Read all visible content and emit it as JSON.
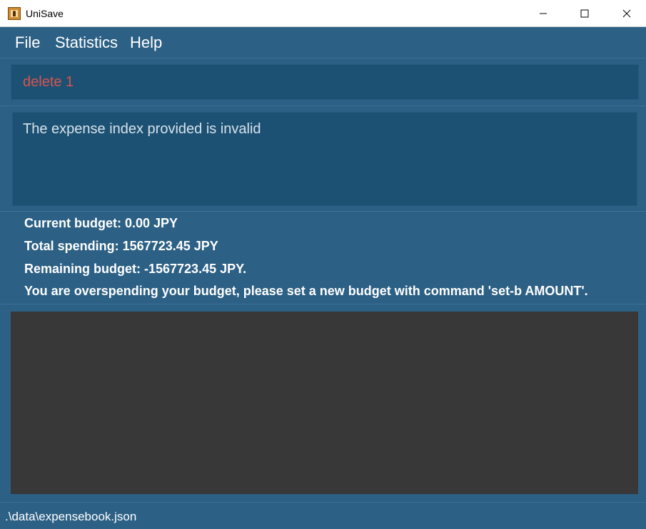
{
  "window": {
    "title": "UniSave"
  },
  "menu": {
    "file": "File",
    "statistics": "Statistics",
    "help": "Help"
  },
  "command_box": {
    "value": "delete 1",
    "color": "#d9534f"
  },
  "result_display": {
    "message": "The expense index provided is invalid"
  },
  "budget": {
    "current": "Current budget: 0.00 JPY",
    "total_spending": "Total spending: 1567723.45 JPY",
    "remaining": "Remaining budget: -1567723.45 JPY.",
    "warning": "You are overspending your budget, please set a new budget with command 'set-b AMOUNT'."
  },
  "expense_list": {
    "items": []
  },
  "status_bar": {
    "file_path": ".\\data\\expensebook.json"
  },
  "colors": {
    "background": "#2c6085",
    "panel": "#1d5173",
    "list_background": "#383838"
  }
}
